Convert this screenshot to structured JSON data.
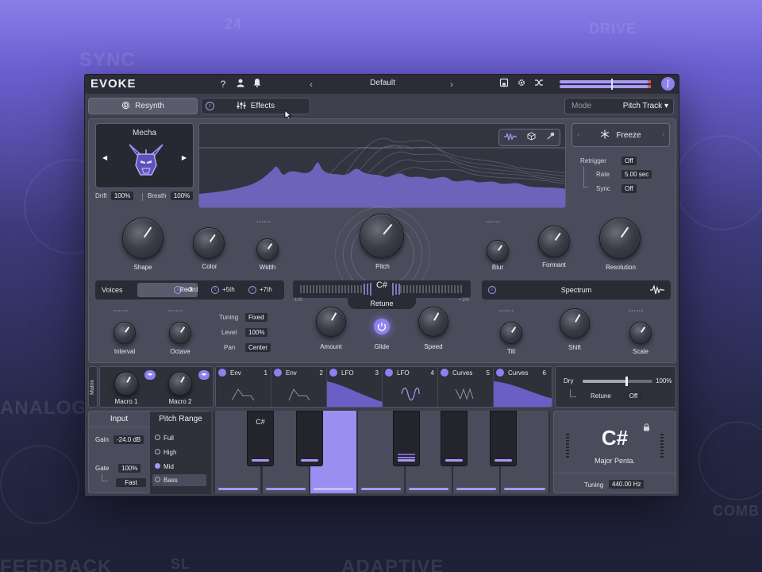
{
  "background_words": [
    "SYNC",
    "24",
    "DRIVE",
    "ANALOG",
    "FEEDBACK",
    "ADAPTIVE",
    "COMB",
    "SL"
  ],
  "topbar": {
    "logo": "EVOKE",
    "help_icon": "?",
    "preset_name": "Default",
    "prev_icon": "chevron-left-icon",
    "next_icon": "chevron-right-icon"
  },
  "tabs": {
    "resynth": "Resynth",
    "effects": "Effects"
  },
  "mode": {
    "label": "Mode",
    "value": "Pitch Track"
  },
  "mecha": {
    "name": "Mecha",
    "drift_label": "Drift",
    "drift_value": "100%",
    "breath_label": "Breath",
    "breath_value": "100%"
  },
  "freeze": {
    "label": "Freeze"
  },
  "retrigger": {
    "retrigger_label": "Retrigger",
    "retrigger_value": "Off",
    "rate_label": "Rate",
    "rate_value": "5.00 sec",
    "sync_label": "Sync",
    "sync_value": "Off"
  },
  "knobs_top": {
    "shape": "Shape",
    "color": "Color",
    "width": "Width",
    "pitch": "Pitch",
    "blur": "Blur",
    "formant": "Formant",
    "resolution": "Resolution"
  },
  "voices": {
    "label": "Voices",
    "root": "Root",
    "opt1": "+3rd",
    "opt2": "+5th",
    "opt3": "+7th",
    "interval": "Interval",
    "octave": "Octave",
    "tuning_label": "Tuning",
    "tuning_value": "Fixed",
    "level_label": "Level",
    "level_value": "100%",
    "pan_label": "Pan",
    "pan_value": "Center"
  },
  "retune": {
    "note": "C#",
    "min": "-100",
    "max": "+100",
    "label": "Retune",
    "amount": "Amount",
    "glide": "Glide",
    "speed": "Speed"
  },
  "spectrum": {
    "label": "Spectrum",
    "tilt": "Tilt",
    "shift": "Shift",
    "scale": "Scale"
  },
  "matrix": {
    "label": "Matrix",
    "macro1": "Macro 1",
    "macro2": "Macro 2"
  },
  "mods": [
    {
      "name": "Env",
      "num": "1"
    },
    {
      "name": "Env",
      "num": "2"
    },
    {
      "name": "LFO",
      "num": "3"
    },
    {
      "name": "LFO",
      "num": "4"
    },
    {
      "name": "Curves",
      "num": "5"
    },
    {
      "name": "Curves",
      "num": "6"
    }
  ],
  "dry": {
    "label": "Dry",
    "value": "100%",
    "retune_label": "Retune",
    "retune_value": "Off"
  },
  "input": {
    "header": "Input",
    "gain_label": "Gain",
    "gain_value": "-24.0 dB",
    "gate_label": "Gate",
    "gate_value": "100%",
    "gate_mode": "Fast"
  },
  "pitch_range": {
    "header": "Pitch Range",
    "options": [
      "Full",
      "High",
      "Mid",
      "Bass"
    ],
    "selected": "Mid"
  },
  "keys": {
    "key_label": "C#"
  },
  "note_display": {
    "note": "C#",
    "scale": "Major Penta.",
    "tuning_label": "Tuning",
    "tuning_value": "440.00 Hz"
  },
  "colors": {
    "accent": "#8f80f0",
    "panel": "#4a4c5c",
    "dark": "#2f3039"
  }
}
